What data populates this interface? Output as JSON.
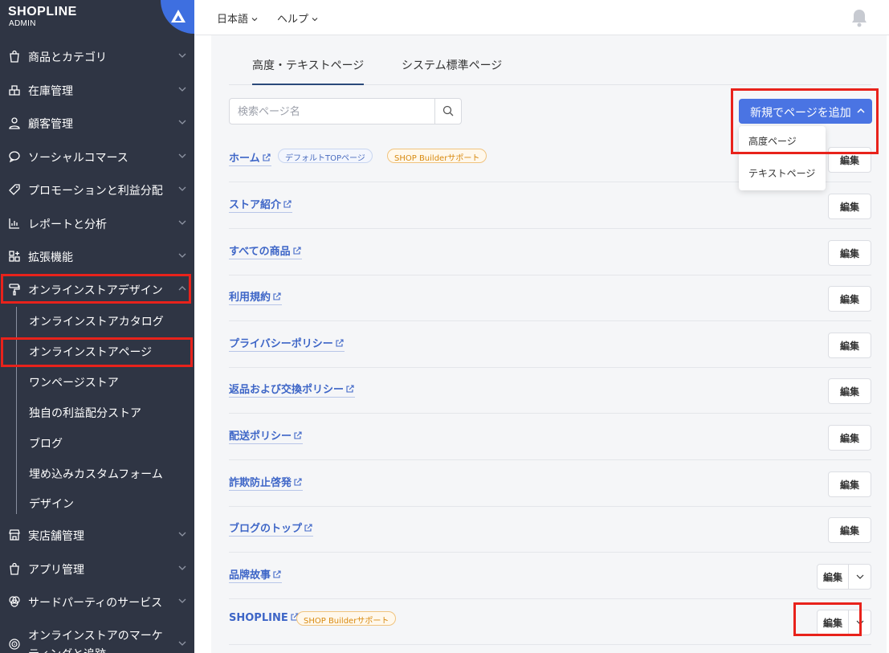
{
  "brand": {
    "logo": "SHOPLINE",
    "sub": "ADMIN"
  },
  "topbar": {
    "language": "日本語",
    "help": "ヘルプ"
  },
  "sidebar": {
    "items": [
      {
        "label": "商品とカテゴリ",
        "icon": "bag-icon"
      },
      {
        "label": "在庫管理",
        "icon": "inventory-icon"
      },
      {
        "label": "顧客管理",
        "icon": "user-icon"
      },
      {
        "label": "ソーシャルコマース",
        "icon": "chat-icon"
      },
      {
        "label": "プロモーションと利益分配",
        "icon": "tag-icon"
      },
      {
        "label": "レポートと分析",
        "icon": "report-icon"
      },
      {
        "label": "拡張機能",
        "icon": "apps-icon"
      },
      {
        "label": "オンラインストアデザイン",
        "icon": "paint-roller-icon"
      }
    ],
    "subitems": [
      {
        "label": "オンラインストアカタログ"
      },
      {
        "label": "オンラインストアページ"
      },
      {
        "label": "ワンページストア"
      },
      {
        "label": "独自の利益配分ストア"
      },
      {
        "label": "ブログ"
      },
      {
        "label": "埋め込みカスタムフォーム"
      },
      {
        "label": "デザイン"
      }
    ],
    "items2": [
      {
        "label": "実店舗管理",
        "icon": "store-icon"
      },
      {
        "label": "アプリ管理",
        "icon": "bag-icon"
      },
      {
        "label": "サードパーティのサービス",
        "icon": "network-icon"
      },
      {
        "label": "オンラインストアのマーケ",
        "label2": "ティングと追跡",
        "icon": "target-icon"
      }
    ]
  },
  "tabs": {
    "active": "高度・テキストページ",
    "other": "システム標準ページ"
  },
  "search": {
    "placeholder": "検索ページ名"
  },
  "add_button": {
    "label": "新規でページを追加"
  },
  "dropdown": {
    "options": [
      "高度ページ",
      "テキストページ"
    ]
  },
  "tags": {
    "default_top": "デフォルトTOPページ",
    "builder": "SHOP Builderサポート"
  },
  "edit_label": "編集",
  "pages": [
    {
      "name": "ホーム"
    },
    {
      "name": "ストア紹介"
    },
    {
      "name": "すべての商品"
    },
    {
      "name": "利用規約"
    },
    {
      "name": "プライバシーポリシー"
    },
    {
      "name": "返品および交換ポリシー"
    },
    {
      "name": "配送ポリシー"
    },
    {
      "name": "詐欺防止啓発"
    },
    {
      "name": "ブログのトップ"
    },
    {
      "name": "品牌故事"
    },
    {
      "name": "SHOPLINE"
    }
  ],
  "colors": {
    "sidebar_bg": "#2f3544",
    "accent": "#4a74e3",
    "highlight": "#e8221b",
    "link": "#3e66c7"
  }
}
